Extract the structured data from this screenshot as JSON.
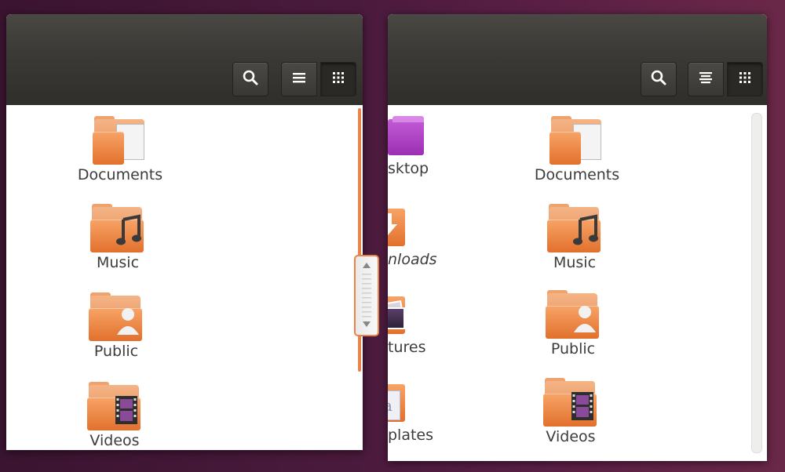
{
  "colors": {
    "accent": "#e95420",
    "folder": "#e98d52",
    "toolbar": "#3c3b37",
    "desktop": "#4a1a3c"
  },
  "left_window": {
    "toolbar": {
      "search_icon": "search-icon",
      "list_view_icon": "list-icon",
      "grid_view_icon": "grid-icon"
    },
    "items": [
      {
        "label": "Documents",
        "icon": "document-folder-icon"
      },
      {
        "label": "Music",
        "icon": "music-folder-icon"
      },
      {
        "label": "Public",
        "icon": "public-folder-icon"
      },
      {
        "label": "Videos",
        "icon": "video-folder-icon"
      }
    ]
  },
  "right_window": {
    "toolbar": {
      "search_icon": "search-icon",
      "options_view_icon": "view-options-icon",
      "grid_view_icon": "grid-icon"
    },
    "left_column": [
      {
        "label": "sktop",
        "icon": "desktop-folder-icon"
      },
      {
        "label": "nloads",
        "icon": "downloads-folder-icon"
      },
      {
        "label": "tures",
        "icon": "pictures-folder-icon"
      },
      {
        "label": "plates",
        "icon": "templates-folder-icon"
      }
    ],
    "right_column": [
      {
        "label": "Documents",
        "icon": "document-folder-icon"
      },
      {
        "label": "Music",
        "icon": "music-folder-icon"
      },
      {
        "label": "Public",
        "icon": "public-folder-icon"
      },
      {
        "label": "Videos",
        "icon": "video-folder-icon"
      }
    ]
  }
}
